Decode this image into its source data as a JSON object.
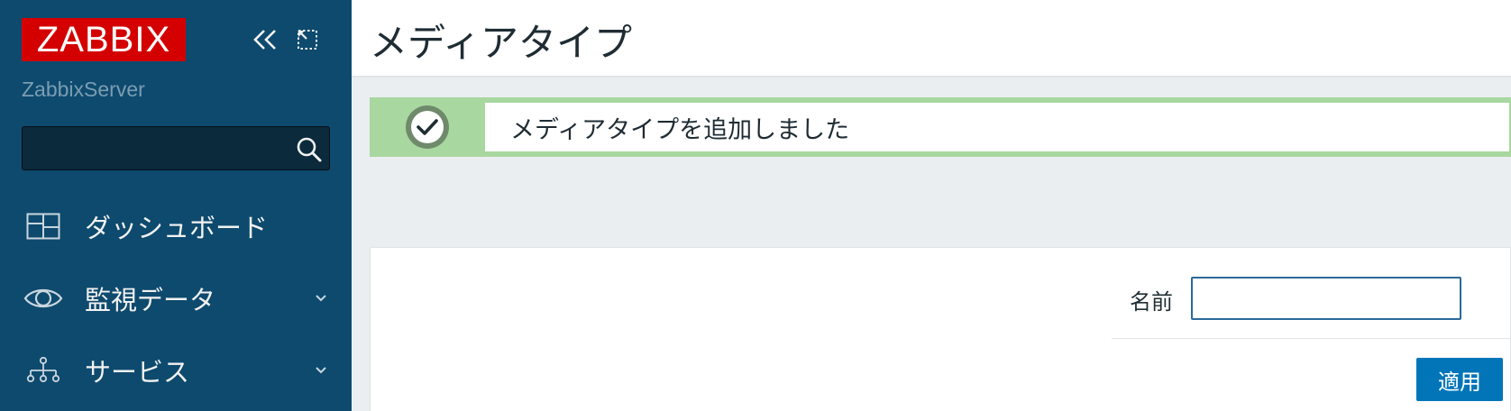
{
  "app": {
    "logo_text": "ZABBIX",
    "server_name": "ZabbixServer"
  },
  "sidebar": {
    "search_value": "",
    "items": [
      {
        "label": "ダッシュボード",
        "icon": "dashboard-icon",
        "has_submenu": false
      },
      {
        "label": "監視データ",
        "icon": "eye-icon",
        "has_submenu": true
      },
      {
        "label": "サービス",
        "icon": "hierarchy-icon",
        "has_submenu": true
      }
    ]
  },
  "header": {
    "title": "メディアタイプ"
  },
  "message": {
    "type": "success",
    "text": "メディアタイプを追加しました"
  },
  "filter": {
    "name_label": "名前",
    "name_value": "",
    "apply_label": "適用"
  },
  "colors": {
    "sidebar_bg": "#0e4a6e",
    "logo_red": "#d40000",
    "success_green": "#a8d7a0",
    "primary_button": "#0275b8"
  }
}
